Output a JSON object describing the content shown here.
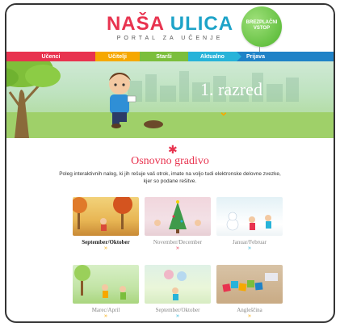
{
  "header": {
    "logo_part1": "NAŠA",
    "logo_part2": "ULICA",
    "subtitle": "PORTAL ZA UČENJE",
    "balloon_text": "BREZPLAČNI VSTOP"
  },
  "nav": [
    {
      "label": "Učenci",
      "color": "#e8334f"
    },
    {
      "label": "Učitelji",
      "color": "#f6a800"
    },
    {
      "label": "Starši",
      "color": "#7bbe3c"
    },
    {
      "label": "Aktualno",
      "color": "#27b3d9"
    },
    {
      "label": "Prijava",
      "color": "#1f82c7"
    }
  ],
  "hero": {
    "title": "1. razred",
    "chevron": "»"
  },
  "section": {
    "ornament": "✱",
    "title": "Osnovno gradivo",
    "description": "Poleg interaktivnih nalog, ki jih rešuje vaš otrok, imate na voljo tudi elektronske delovne zvezke, kjer so podane rešitve."
  },
  "cards": [
    {
      "caption": "September/Oktober",
      "active": true,
      "chevron": "»",
      "chevron_color": "#f6a800"
    },
    {
      "caption": "November/December",
      "active": false,
      "chevron": "»",
      "chevron_color": "#e8334f"
    },
    {
      "caption": "Januar/Februar",
      "active": false,
      "chevron": "»",
      "chevron_color": "#27b3d9"
    },
    {
      "caption": "Marec/April",
      "active": false,
      "chevron": "»",
      "chevron_color": "#f6a800"
    },
    {
      "caption": "September/Oktober",
      "active": false,
      "chevron": "»",
      "chevron_color": "#27b3d9"
    },
    {
      "caption": "Angleščina",
      "active": false,
      "chevron": "»",
      "chevron_color": "#f6a800"
    }
  ]
}
